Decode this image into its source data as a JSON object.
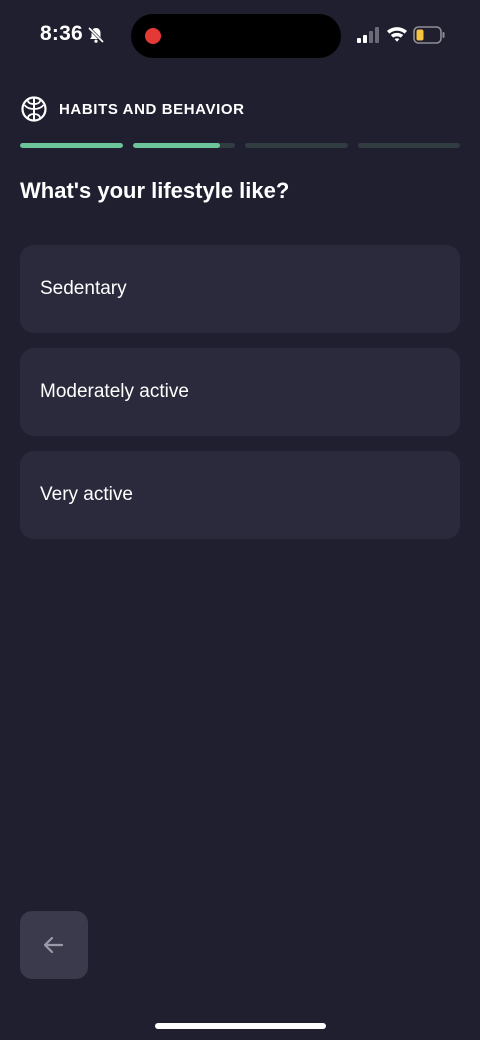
{
  "status_bar": {
    "time": "8:36",
    "icons": [
      "bell-slash-icon",
      "recording-dot-icon",
      "signal-icon",
      "wifi-icon",
      "battery-low-icon"
    ],
    "recording_color": "#e53935",
    "battery_color": "#f5c542"
  },
  "header": {
    "icon": "brain-icon",
    "title": "HABITS AND BEHAVIOR"
  },
  "progress": {
    "segments": [
      1,
      0.85,
      0,
      0
    ],
    "accent": "#6cc59a"
  },
  "question": "What's your lifestyle like?",
  "options": [
    {
      "label": "Sedentary"
    },
    {
      "label": "Moderately active"
    },
    {
      "label": "Very active"
    }
  ],
  "footer": {
    "back_icon": "arrow-left-icon"
  }
}
